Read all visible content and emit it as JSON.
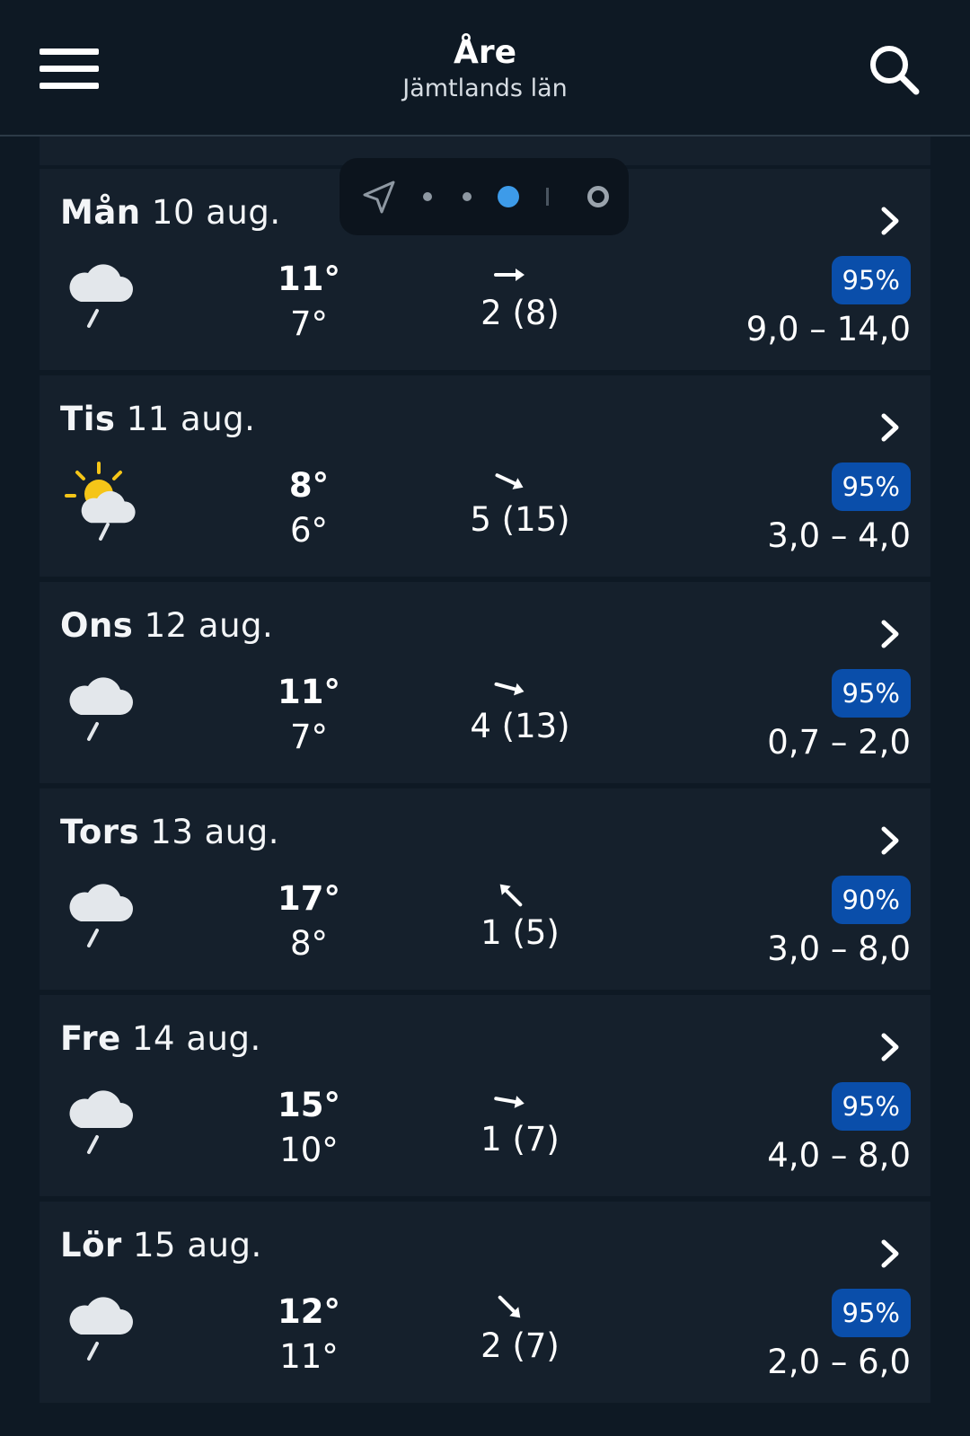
{
  "header": {
    "city": "Åre",
    "region": "Jämtlands län",
    "menu_icon": "hamburger-menu-icon",
    "search_icon": "search-icon"
  },
  "pager": {
    "nav_icon": "location-arrow-icon",
    "pages": 3,
    "active_page": 3
  },
  "colors": {
    "background": "#0e1924",
    "card": "#15202c",
    "badge": "#0a4eaa",
    "active_dot": "#3d9be9",
    "sun": "#f5c518"
  },
  "days": [
    {
      "weekday": "Mån",
      "date": "10 aug.",
      "icon": "rain-cloud-icon",
      "max": "11°",
      "min": "7°",
      "wind_dir_deg": 90,
      "wind": "2 (8)",
      "prob": "95%",
      "precip": "9,0 – 14,0"
    },
    {
      "weekday": "Tis",
      "date": "11 aug.",
      "icon": "sun-cloud-rain-icon",
      "max": "8°",
      "min": "6°",
      "wind_dir_deg": 115,
      "wind": "5 (15)",
      "prob": "95%",
      "precip": "3,0 – 4,0"
    },
    {
      "weekday": "Ons",
      "date": "12 aug.",
      "icon": "rain-cloud-icon",
      "max": "11°",
      "min": "7°",
      "wind_dir_deg": 105,
      "wind": "4 (13)",
      "prob": "95%",
      "precip": "0,7 – 2,0"
    },
    {
      "weekday": "Tors",
      "date": "13 aug.",
      "icon": "rain-cloud-icon",
      "max": "17°",
      "min": "8°",
      "wind_dir_deg": 315,
      "wind": "1 (5)",
      "prob": "90%",
      "precip": "3,0 – 8,0"
    },
    {
      "weekday": "Fre",
      "date": "14 aug.",
      "icon": "rain-cloud-icon",
      "max": "15°",
      "min": "10°",
      "wind_dir_deg": 100,
      "wind": "1 (7)",
      "prob": "95%",
      "precip": "4,0 – 8,0"
    },
    {
      "weekday": "Lör",
      "date": "15 aug.",
      "icon": "rain-cloud-icon",
      "max": "12°",
      "min": "11°",
      "wind_dir_deg": 135,
      "wind": "2 (7)",
      "prob": "95%",
      "precip": "2,0 – 6,0"
    }
  ]
}
